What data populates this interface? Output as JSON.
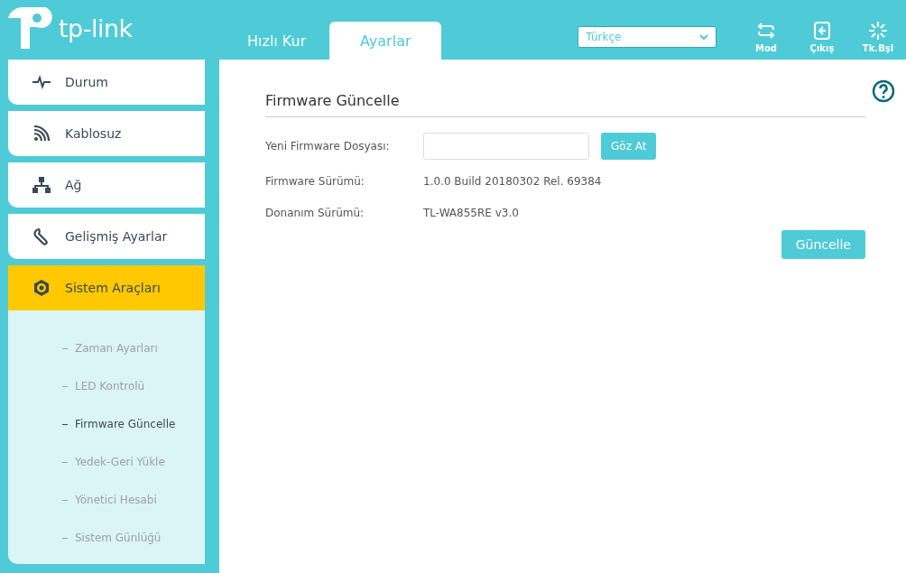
{
  "header": {
    "logo": "tp-link",
    "tabs": [
      {
        "label": "Hızlı Kur",
        "selected": false
      },
      {
        "label": "Ayarlar",
        "selected": true
      }
    ],
    "language": {
      "value": "Türkçe"
    },
    "actions": [
      {
        "kind": "mode",
        "label": "Mod"
      },
      {
        "kind": "logout",
        "label": "Çıkış"
      },
      {
        "kind": "reboot",
        "label": "Tk.Bşl"
      }
    ]
  },
  "sidebar": {
    "items": [
      {
        "kind": "status",
        "label": "Durum",
        "selected": false
      },
      {
        "kind": "wireless",
        "label": "Kablosuz",
        "selected": false
      },
      {
        "kind": "network",
        "label": "Ağ",
        "selected": false
      },
      {
        "kind": "advanced",
        "label": "Gelişmiş Ayarlar",
        "selected": false
      },
      {
        "kind": "tools",
        "label": "Sistem Araçları",
        "selected": true,
        "expanded": true,
        "children": [
          {
            "label": "Zaman Ayarları",
            "selected": false
          },
          {
            "label": "LED Kontrolü",
            "selected": false
          },
          {
            "label": "Firmware Güncelle",
            "selected": true
          },
          {
            "label": "Yedek-Geri Yükle",
            "selected": false
          },
          {
            "label": "Yönetici Hesabi",
            "selected": false
          },
          {
            "label": "Sistem Günlüğü",
            "selected": false
          }
        ]
      }
    ]
  },
  "content": {
    "title": "Firmware Güncelle",
    "file_row": {
      "label": "Yeni Firmware Dosyası:",
      "button": "Göz At"
    },
    "info_rows": [
      {
        "label": "Firmware Sürümü:",
        "value": "1.0.0 Build 20180302 Rel. 69384"
      },
      {
        "label": "Donanım Sürümü:",
        "value": "TL-WA855RE v3.0"
      }
    ],
    "submit": "Güncelle"
  }
}
